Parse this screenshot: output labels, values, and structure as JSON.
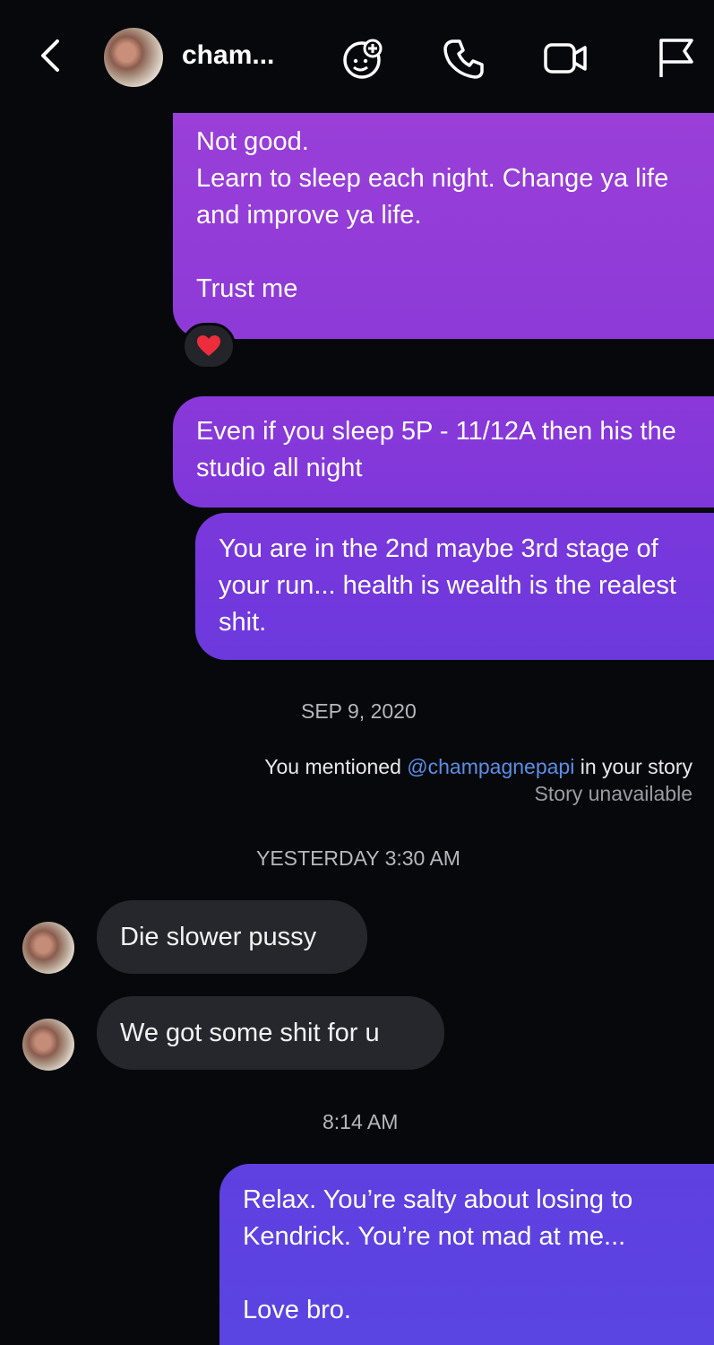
{
  "header": {
    "title": "cham...",
    "icons": [
      "back-chevron-icon",
      "avatar",
      "sticker-plus-icon",
      "phone-icon",
      "video-icon",
      "flag-icon"
    ]
  },
  "messages": {
    "out1": "Not good.\nLearn to sleep each night. Change ya life and improve ya life.\n\nTrust me",
    "reaction": "❤️",
    "out2": "Even if you sleep 5P - 11/12A then his the studio all night",
    "out3": "You are in the 2nd maybe 3rd stage of your run... health is wealth is the realest shit.",
    "date1": "SEP 9, 2020",
    "mention": {
      "prefix": "You mentioned ",
      "handle": "@champagnepapi",
      "suffix": " in your story",
      "status": "Story unavailable"
    },
    "date2": "YESTERDAY 3:30 AM",
    "in1": "Die slower pussy",
    "in2": "We got some shit for u",
    "time3": "8:14 AM",
    "out4": "Relax. You’re salty about losing to Kendrick. You’re not mad at me...\n\nLove bro."
  },
  "colors": {
    "background": "#07080c",
    "outgoing_top": "#9a3fd8",
    "outgoing_bottom": "#5a44e2",
    "incoming": "#25272d",
    "handle": "#5b8fe6"
  }
}
